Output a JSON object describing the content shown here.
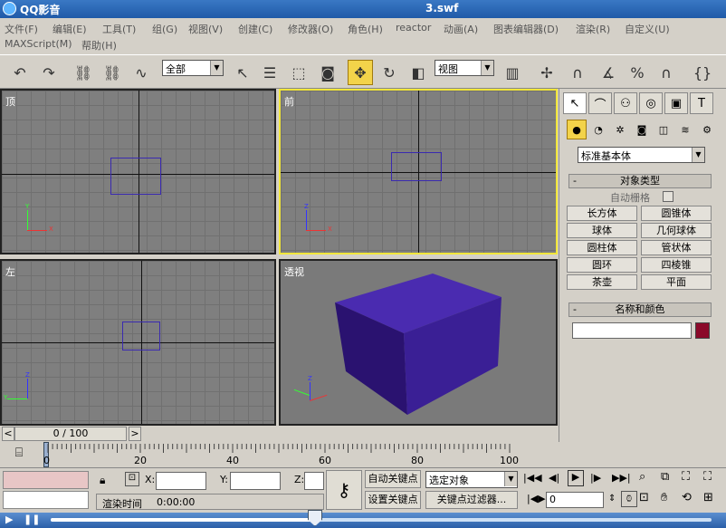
{
  "titlebar": {
    "app_name": "QQ影音",
    "file_name": "3.swf"
  },
  "menu": {
    "row1": [
      "文件(F)",
      "编辑(E)",
      "工具(T)",
      "组(G)",
      "视图(V)",
      "创建(C)",
      "修改器(O)",
      "角色(H)",
      "reactor",
      "动画(A)",
      "图表编辑器(D)",
      "渲染(R)",
      "自定义(U)"
    ],
    "row2": [
      "MAXScript(M)",
      "帮助(H)"
    ]
  },
  "toolbar": {
    "selection_filter": "全部",
    "ref_coord": "视图"
  },
  "viewports": {
    "top": "顶",
    "front": "前",
    "left": "左",
    "persp": "透视"
  },
  "axis": {
    "x": "X",
    "y": "Y",
    "z": "Z"
  },
  "colors": {
    "box_top": "#4a2bb0",
    "box_front": "#2a1270",
    "box_side": "#3a1f95",
    "active_border": "#f1e63b",
    "color_swatch": "#8b0a2a"
  },
  "panel": {
    "category_select": "标准基本体",
    "rollout_object_type": "对象类型",
    "auto_grid": "自动栅格",
    "objects": [
      "长方体",
      "圆锥体",
      "球体",
      "几何球体",
      "圆柱体",
      "管状体",
      "圆环",
      "四棱锥",
      "茶壶",
      "平面"
    ],
    "rollout_name_color": "名称和颜色",
    "name_value": ""
  },
  "timeline": {
    "frame_range": "0 / 100",
    "ticks": [
      "0",
      "20",
      "40",
      "60",
      "80",
      "100"
    ]
  },
  "status": {
    "x_label": "X:",
    "y_label": "Y:",
    "z_label": "Z:",
    "render_time_label": "渲染时间",
    "render_time_value": "0:00:00",
    "auto_key": "自动关键点",
    "set_key": "设置关键点",
    "key_mode_select": "选定对象",
    "key_filters": "关键点过滤器...",
    "current_frame": "0"
  },
  "player": {
    "progress": 0.4
  }
}
